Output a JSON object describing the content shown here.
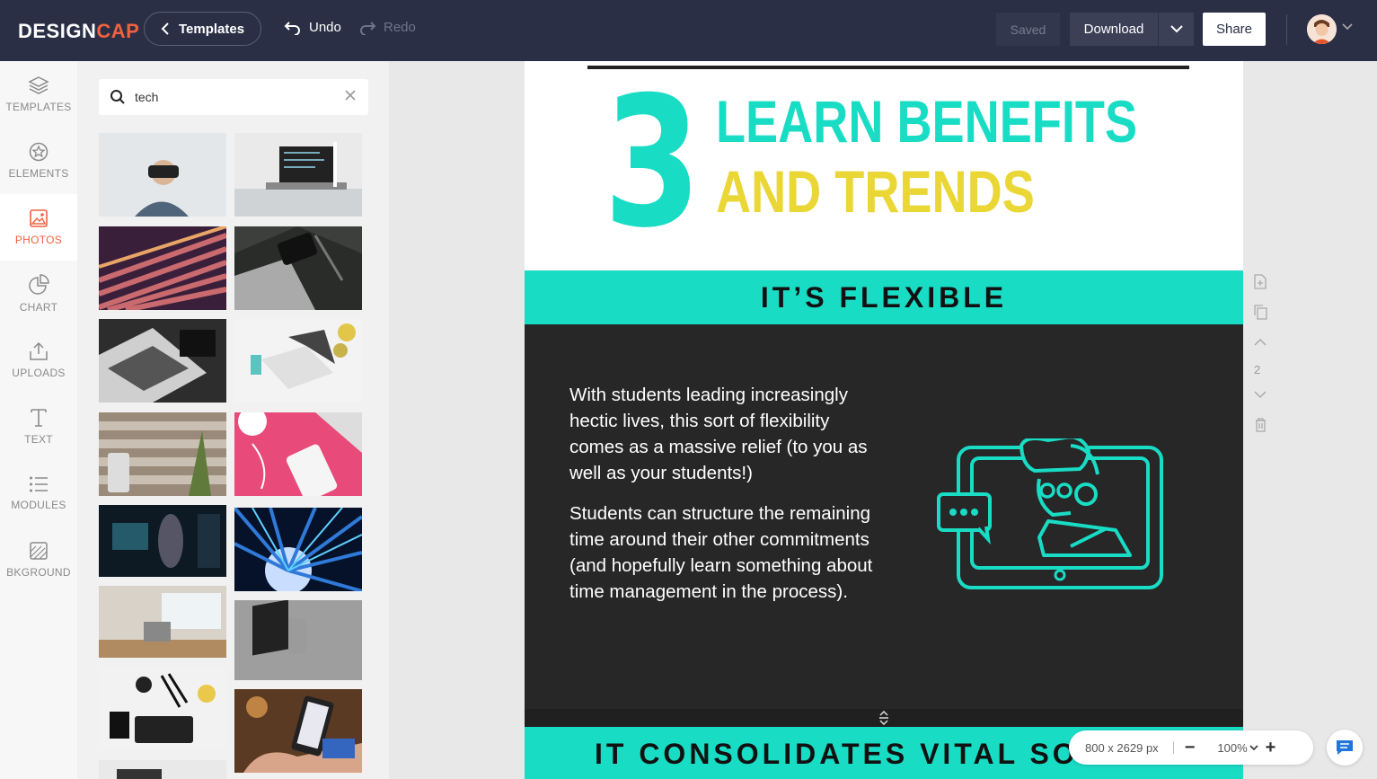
{
  "topbar": {
    "logo_main": "DESIGN",
    "logo_accent": "CAP",
    "templates_label": "Templates",
    "undo_label": "Undo",
    "redo_label": "Redo",
    "saved_label": "Saved",
    "download_label": "Download",
    "share_label": "Share"
  },
  "nav": {
    "items": [
      {
        "label": "TEMPLATES",
        "icon": "layers-icon"
      },
      {
        "label": "ELEMENTS",
        "icon": "elements-icon"
      },
      {
        "label": "PHOTOS",
        "icon": "photo-icon",
        "active": true
      },
      {
        "label": "CHART",
        "icon": "pie-chart-icon"
      },
      {
        "label": "UPLOADS",
        "icon": "upload-icon"
      },
      {
        "label": "TEXT",
        "icon": "text-icon"
      },
      {
        "label": "MODULES",
        "icon": "list-icon"
      },
      {
        "label": "BKGROUND",
        "icon": "background-icon"
      }
    ]
  },
  "panel": {
    "search_value": "tech",
    "photos": [
      {
        "subject": "vr-headset-man"
      },
      {
        "subject": "laptop-desk"
      },
      {
        "subject": "fiber-cables-purple"
      },
      {
        "subject": "laptop-phone-dark"
      },
      {
        "subject": "laptop-notebook-pen"
      },
      {
        "subject": "white-laptop-flowers"
      },
      {
        "subject": "phone-pineapple-wood"
      },
      {
        "subject": "phone-earbuds-pink"
      },
      {
        "subject": "robot-futuristic"
      },
      {
        "subject": "fiber-optic-blue"
      },
      {
        "subject": "room-window-desk"
      },
      {
        "subject": "laptop-grey-dark"
      },
      {
        "subject": "flatlay-keyboard"
      },
      {
        "subject": "phone-credit-card"
      },
      {
        "subject": "flatlay-partial"
      },
      {
        "subject": "partial-2"
      }
    ]
  },
  "design": {
    "number": "3",
    "heading_line1": "LEARN BENEFITS",
    "heading_line2": "AND TRENDS",
    "section1_title": "IT’S FLEXIBLE",
    "paragraph1": "With students leading increasingly hectic lives, this sort of flexibility comes as a massive relief (to you as well as your students!)",
    "paragraph2": "Students can structure the remaining time around their other commitments (and hopefully learn something about time management in the process).",
    "section2_title": "IT CONSOLIDATES VITAL SOFT S",
    "colors": {
      "teal": "#19dcc5",
      "yellow": "#ead735",
      "dark": "#272727"
    }
  },
  "page_tools": {
    "page_number": "2"
  },
  "zoom": {
    "dimensions": "800 x 2629 px",
    "percent": "100%",
    "minus": "−",
    "plus": "+"
  }
}
